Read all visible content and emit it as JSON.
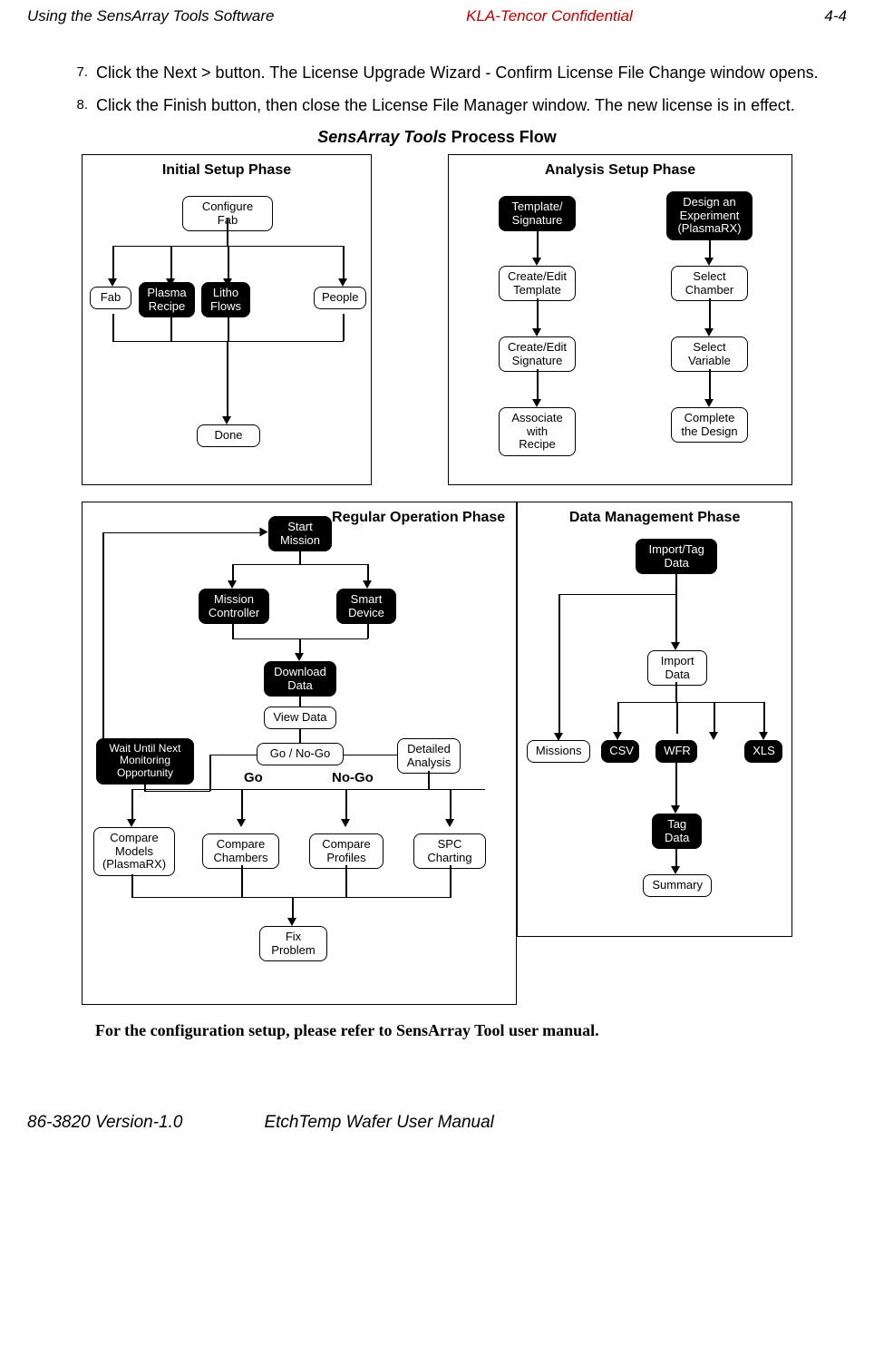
{
  "header": {
    "left": "Using the SensArray Tools Software",
    "center": "KLA-Tencor Confidential",
    "right": "4-4"
  },
  "steps": {
    "s7_num": "7.",
    "s7_text": "Click the Next > button. The License Upgrade Wizard - Confirm License File Change window opens.",
    "s8_num": "8.",
    "s8_text": "Click the Finish button, then close the License File Manager window. The new license is in effect."
  },
  "flow_title_italic": "SensArray Tools",
  "flow_title_rest": " Process Flow",
  "phases": {
    "initial": {
      "title": "Initial Setup Phase",
      "configure_fab": "Configure Fab",
      "fab": "Fab",
      "plasma_recipe": "Plasma\nRecipe",
      "litho_flows": "Litho\nFlows",
      "people": "People",
      "done": "Done"
    },
    "analysis": {
      "title": "Analysis Setup Phase",
      "template_signature": "Template/\nSignature",
      "design_experiment": "Design an\nExperiment\n(PlasmaRX)",
      "create_edit_template": "Create/Edit\nTemplate",
      "select_chamber": "Select\nChamber",
      "create_edit_signature": "Create/Edit\nSignature",
      "select_variable": "Select\nVariable",
      "associate_recipe": "Associate\nwith Recipe",
      "complete_design": "Complete\nthe Design"
    },
    "regular": {
      "title": "Regular Operation Phase",
      "start_mission": "Start\nMission",
      "mission_controller": "Mission\nController",
      "smart_device": "Smart\nDevice",
      "download_data": "Download\nData",
      "view_data": "View Data",
      "go_nogo": "Go / No-Go",
      "wait_monitoring": "Wait Until Next\nMonitoring\nOpportunity",
      "detailed_analysis": "Detailed\nAnalysis",
      "go_label": "Go",
      "nogo_label": "No-Go",
      "compare_models": "Compare\nModels\n(PlasmaRX)",
      "compare_chambers": "Compare\nChambers",
      "compare_profiles": "Compare\nProfiles",
      "spc_charting": "SPC\nCharting",
      "fix_problem": "Fix\nProblem"
    },
    "data": {
      "title": "Data Management Phase",
      "import_tag": "Import/Tag\nData",
      "import_data": "Import\nData",
      "missions": "Missions",
      "csv": "CSV",
      "wfr": "WFR",
      "xls": "XLS",
      "tag_data": "Tag\nData",
      "summary": "Summary"
    }
  },
  "bottom_note": "For the configuration setup, please refer to SensArray Tool user manual.",
  "footer": {
    "left": "86-3820 Version-1.0",
    "right": "EtchTemp Wafer User Manual"
  }
}
